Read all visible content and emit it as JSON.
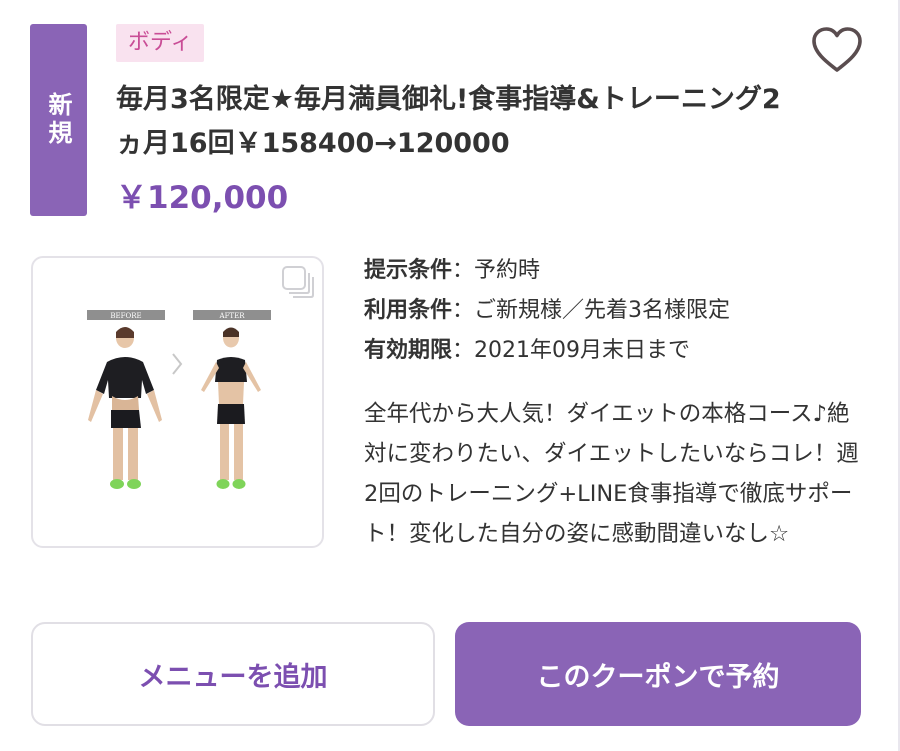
{
  "badge": {
    "new_label": "新規"
  },
  "category": "ボディ",
  "favorite": {
    "icon": "heart-icon",
    "color": "#5a4d4f"
  },
  "coupon": {
    "title": "毎月3名限定★毎月満員御礼!食事指導&トレーニング2ヵ月16回￥158400→120000",
    "price": "￥120,000"
  },
  "photo": {
    "before_label": "BEFORE",
    "after_label": "AFTER",
    "multi_photo_icon": "multi-photo-icon"
  },
  "conditions": [
    {
      "label": "提示条件",
      "sep": "：",
      "value": "予約時"
    },
    {
      "label": "利用条件",
      "sep": "：",
      "value": "ご新規様／先着3名様限定"
    },
    {
      "label": "有効期限",
      "sep": "：",
      "value": "2021年09月末日まで"
    }
  ],
  "description": "全年代から大人気！ダイエットの本格コース♪絶対に変わりたい、ダイエットしたいならコレ！週2回のトレーニング+LINE食事指導で徹底サポート！変化した自分の姿に感動間違いなし☆",
  "buttons": {
    "add_menu": "メニューを追加",
    "reserve": "このクーポンで予約"
  },
  "colors": {
    "accent": "#8a64b6",
    "price": "#7c4fb0",
    "tag_bg": "#f9e2ef",
    "tag_text": "#c94d96"
  }
}
